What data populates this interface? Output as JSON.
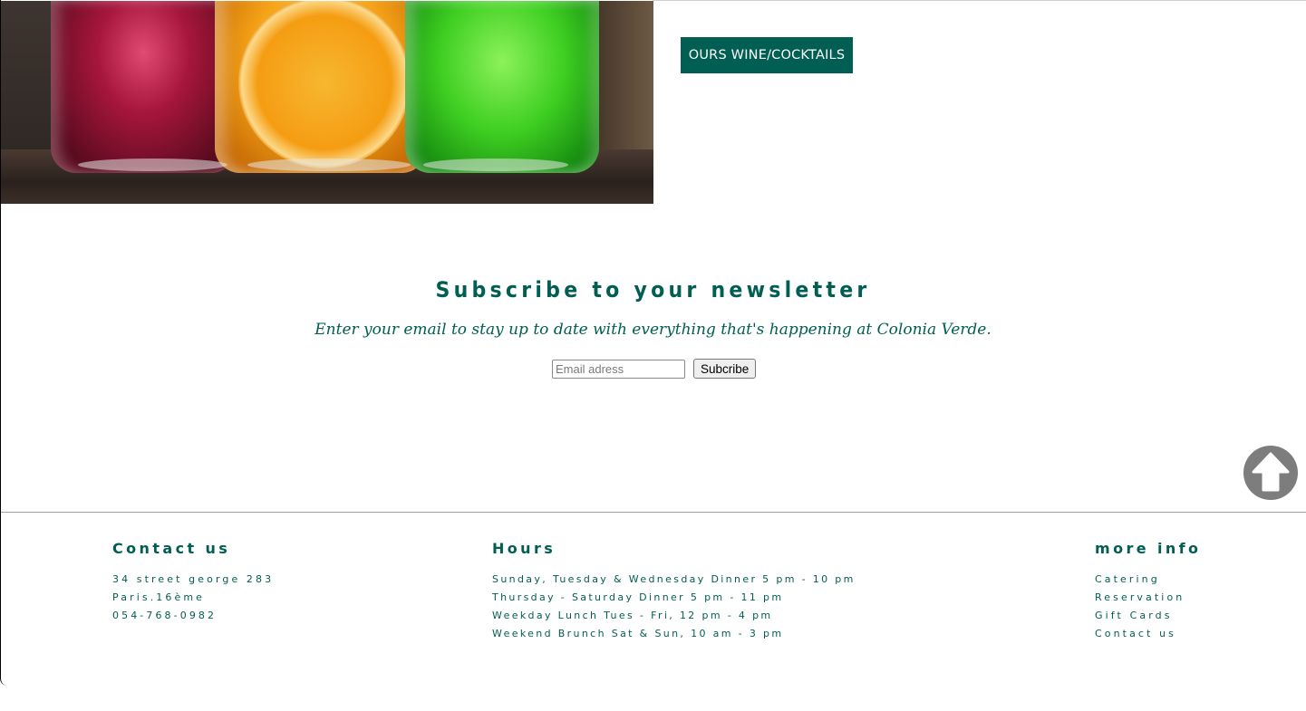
{
  "hero": {
    "button_label": "OURS WINE/COCKTAILS"
  },
  "newsletter": {
    "title": "Subscribe to your newsletter",
    "subtitle": "Enter your email to stay up to date with everything that's happening at Colonia Verde.",
    "email_placeholder": "Email adress",
    "email_value": "",
    "subscribe_label": "Subcribe"
  },
  "back_to_top": {
    "icon": "arrow-up-circle-icon"
  },
  "footer": {
    "contact": {
      "title": "Contact us",
      "lines": [
        "34 street george 283",
        "Paris.16ème",
        "054-768-0982"
      ]
    },
    "hours": {
      "title": "Hours",
      "lines": [
        "Sunday, Tuesday & Wednesday Dinner 5 pm - 10 pm",
        "Thursday - Saturday Dinner 5 pm - 11 pm",
        "Weekday Lunch Tues - Fri, 12 pm - 4 pm",
        "Weekend Brunch Sat & Sun, 10 am - 3 pm"
      ]
    },
    "more_info": {
      "title": "more info",
      "links": [
        "Catering",
        "Reservation",
        "Gift Cards",
        "Contact us"
      ]
    }
  },
  "colors": {
    "brand_green": "#005e52",
    "button_text": "#ffffff",
    "back_to_top": "#7d7d7d"
  }
}
